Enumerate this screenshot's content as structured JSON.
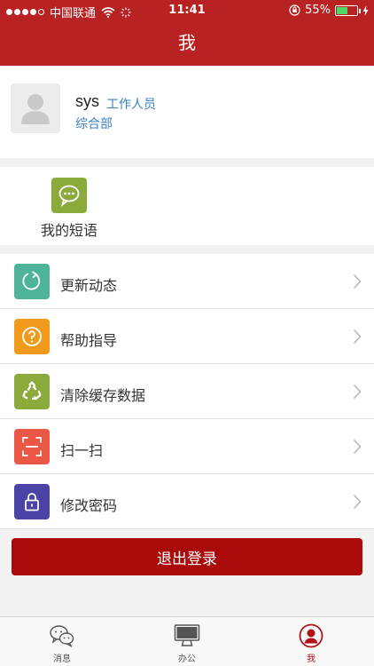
{
  "status_bar": {
    "carrier": "中国联通",
    "time": "11:41",
    "battery": "55%",
    "battery_level": 0.55
  },
  "nav": {
    "title": "我"
  },
  "profile": {
    "name": "sys",
    "role": "工作人员",
    "department": "综合部"
  },
  "shortcuts": [
    {
      "label": "我的短语",
      "icon": "speech-bubble-icon",
      "color": "#8aab3b"
    }
  ],
  "menu": {
    "items": [
      {
        "label": "更新动态",
        "icon": "refresh-icon",
        "color": "#4fb39a"
      },
      {
        "label": "帮助指导",
        "icon": "help-icon",
        "color": "#f29a1b"
      },
      {
        "label": "清除缓存数据",
        "icon": "recycle-icon",
        "color": "#8aab3b"
      },
      {
        "label": "扫一扫",
        "icon": "scan-icon",
        "color": "#ea5744"
      },
      {
        "label": "修改密码",
        "icon": "lock-icon",
        "color": "#4b43a5"
      }
    ]
  },
  "logout": {
    "label": "退出登录",
    "color": "#ab0a0a"
  },
  "tabbar": {
    "tabs": [
      {
        "label": "消息",
        "icon": "chat-icon"
      },
      {
        "label": "办公",
        "icon": "monitor-icon"
      },
      {
        "label": "我",
        "icon": "user-icon",
        "active": true
      }
    ]
  },
  "colors": {
    "brand": "#b82222",
    "accent": "#3a7fc1",
    "active_tab": "#b0131a"
  }
}
